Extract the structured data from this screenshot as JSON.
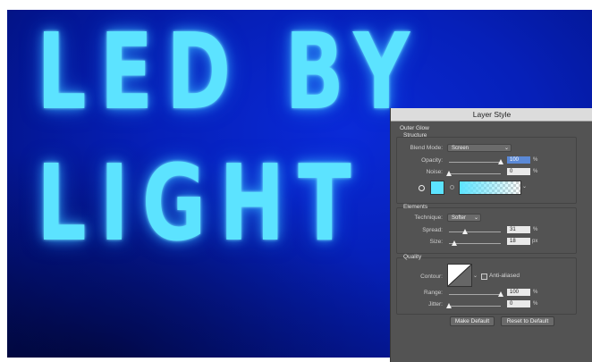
{
  "artwork": {
    "line1": "LED BY",
    "line2": "LIGHT",
    "glow_color": "#5ce3ff",
    "background_color": "#0620b9"
  },
  "dialog": {
    "title": "Layer Style",
    "section": "Outer Glow",
    "structure": {
      "heading": "Structure",
      "blend_mode_label": "Blend Mode:",
      "blend_mode_value": "Screen",
      "opacity_label": "Opacity:",
      "opacity_value": "100",
      "noise_label": "Noise:",
      "noise_value": "0",
      "unit_percent": "%"
    },
    "elements": {
      "heading": "Elements",
      "technique_label": "Technique:",
      "technique_value": "Softer",
      "spread_label": "Spread:",
      "spread_value": "31",
      "size_label": "Size:",
      "size_value": "18",
      "unit_px": "px"
    },
    "quality": {
      "heading": "Quality",
      "contour_label": "Contour:",
      "anti_aliased_label": "Anti-aliased",
      "range_label": "Range:",
      "range_value": "100",
      "jitter_label": "Jitter:",
      "jitter_value": "0"
    },
    "buttons": {
      "make_default": "Make Default",
      "reset_default": "Reset to Default"
    },
    "sliders": {
      "opacity": 1.0,
      "noise": 0.0,
      "spread": 0.31,
      "size": 0.09,
      "range": 1.0,
      "jitter": 0.0
    }
  }
}
